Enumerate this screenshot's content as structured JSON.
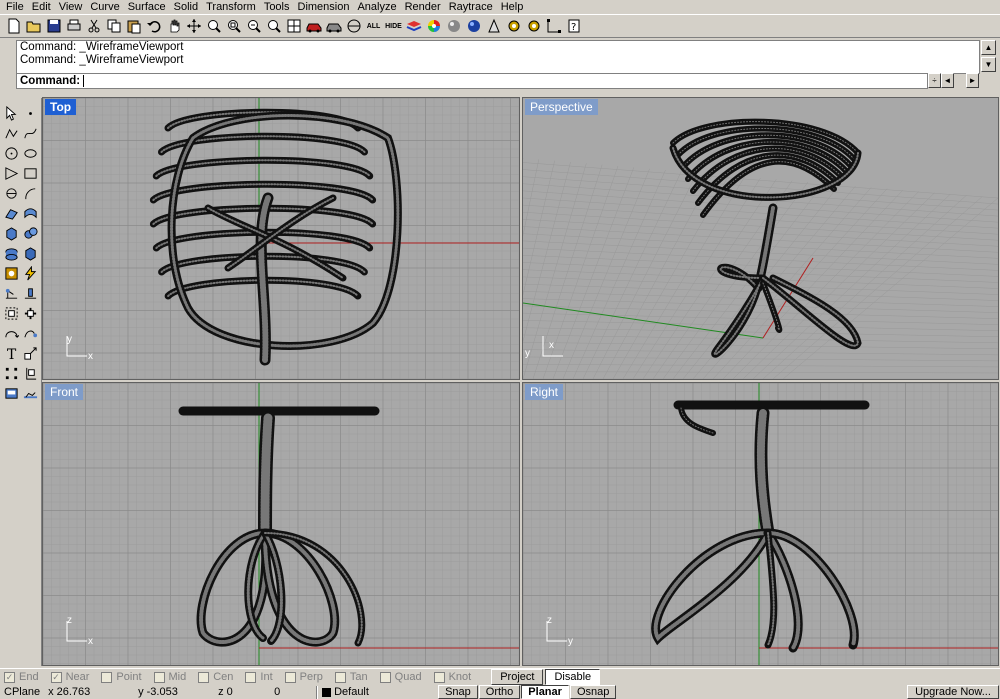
{
  "menu": [
    "File",
    "Edit",
    "View",
    "Curve",
    "Surface",
    "Solid",
    "Transform",
    "Tools",
    "Dimension",
    "Analyze",
    "Render",
    "Raytrace",
    "Help"
  ],
  "toolbar": {
    "all_label": "ALL",
    "hide_label": "HIDE"
  },
  "command": {
    "history": [
      "Command: _WireframeViewport",
      "Command: _WireframeViewport"
    ],
    "prompt_label": "Command:",
    "current_value": ""
  },
  "viewports": {
    "top": {
      "title": "Top",
      "axis_a": "y",
      "axis_b": "x"
    },
    "perspective": {
      "title": "Perspective",
      "axis_a": "y",
      "axis_b": "x"
    },
    "front": {
      "title": "Front",
      "axis_a": "z",
      "axis_b": "x"
    },
    "right": {
      "title": "Right",
      "axis_a": "z",
      "axis_b": "y"
    }
  },
  "osnap": {
    "items": [
      {
        "label": "End",
        "checked": true
      },
      {
        "label": "Near",
        "checked": true
      },
      {
        "label": "Point",
        "checked": false
      },
      {
        "label": "Mid",
        "checked": false
      },
      {
        "label": "Cen",
        "checked": false
      },
      {
        "label": "Int",
        "checked": false
      },
      {
        "label": "Perp",
        "checked": false
      },
      {
        "label": "Tan",
        "checked": false
      },
      {
        "label": "Quad",
        "checked": false
      },
      {
        "label": "Knot",
        "checked": false
      }
    ],
    "project_label": "Project",
    "disable_label": "Disable"
  },
  "status": {
    "cplane": "CPlane",
    "x": "x 26.763",
    "y": "y -3.053",
    "z": "z 0",
    "extra": "0",
    "layer": "Default",
    "snap": "Snap",
    "ortho": "Ortho",
    "planar": "Planar",
    "osnap": "Osnap",
    "upgrade": "Upgrade Now..."
  },
  "colors": {
    "active_viewport_tab": "#1e5fd3",
    "inactive_viewport_tab": "#7f9cc9",
    "grid_bg": "#a8a8a8",
    "x_axis": "#b02020",
    "y_axis": "#208a20"
  }
}
